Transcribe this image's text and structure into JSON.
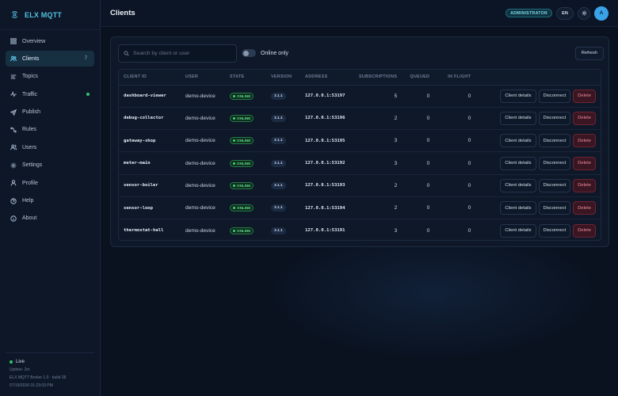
{
  "brand": {
    "name": "ELX MQTT"
  },
  "sidebar": {
    "items": [
      {
        "label": "Overview",
        "icon": "grid-icon"
      },
      {
        "label": "Clients",
        "icon": "users-icon",
        "badge": "7",
        "active": true
      },
      {
        "label": "Topics",
        "icon": "list-icon"
      },
      {
        "label": "Traffic",
        "icon": "activity-icon",
        "live": true
      },
      {
        "label": "Publish",
        "icon": "send-icon"
      },
      {
        "label": "Rules",
        "icon": "rules-icon"
      },
      {
        "label": "Users",
        "icon": "people-icon"
      },
      {
        "label": "Settings",
        "icon": "gear-icon"
      },
      {
        "label": "Profile",
        "icon": "person-icon"
      },
      {
        "label": "Help",
        "icon": "help-icon"
      },
      {
        "label": "About",
        "icon": "info-icon"
      }
    ],
    "footer": {
      "status": "Live",
      "uptime": "Uptime: 2m",
      "version": "ELX MQTT Broker 1.0 · build 28",
      "timestamp": "07/19/2026 01:23:03 PM"
    }
  },
  "header": {
    "title": "Clients",
    "role": "ADMINISTRATOR",
    "language": "EN",
    "avatar_initial": "A"
  },
  "toolbar": {
    "search_placeholder": "Search by client or user",
    "search_value": "",
    "online_only_label": "Online only",
    "online_only": false,
    "refresh_label": "Refresh"
  },
  "table": {
    "columns": [
      "CLIENT ID",
      "USER",
      "STATE",
      "VERSION",
      "ADDRESS",
      "SUBSCRIPTIONS",
      "QUEUED",
      "IN FLIGHT"
    ],
    "action_labels": {
      "details": "Client details",
      "disconnect": "Disconnect",
      "delete": "Delete"
    },
    "rows": [
      {
        "client_id": "dashboard-viewer",
        "user": "demo-device",
        "state": "ONLINE",
        "version": "3.1.1",
        "address": "127.0.0.1:53197",
        "subscriptions": "5",
        "queued": "0",
        "in_flight": "0"
      },
      {
        "client_id": "debug-collector",
        "user": "demo-device",
        "state": "ONLINE",
        "version": "3.1.1",
        "address": "127.0.0.1:53196",
        "subscriptions": "2",
        "queued": "0",
        "in_flight": "0"
      },
      {
        "client_id": "gateway-shop",
        "user": "demo-device",
        "state": "ONLINE",
        "version": "3.1.1",
        "address": "127.0.0.1:53195",
        "subscriptions": "3",
        "queued": "0",
        "in_flight": "0"
      },
      {
        "client_id": "meter-main",
        "user": "demo-device",
        "state": "ONLINE",
        "version": "3.1.1",
        "address": "127.0.0.1:53192",
        "subscriptions": "3",
        "queued": "0",
        "in_flight": "0"
      },
      {
        "client_id": "sensor-boiler",
        "user": "demo-device",
        "state": "ONLINE",
        "version": "3.1.1",
        "address": "127.0.0.1:53193",
        "subscriptions": "2",
        "queued": "0",
        "in_flight": "0"
      },
      {
        "client_id": "sensor-loop",
        "user": "demo-device",
        "state": "ONLINE",
        "version": "3.1.1",
        "address": "127.0.0.1:53194",
        "subscriptions": "2",
        "queued": "0",
        "in_flight": "0"
      },
      {
        "client_id": "thermostat-hall",
        "user": "demo-device",
        "state": "ONLINE",
        "version": "3.1.1",
        "address": "127.0.0.1:53191",
        "subscriptions": "3",
        "queued": "0",
        "in_flight": "0"
      }
    ]
  },
  "colors": {
    "accent": "#52c2e0",
    "online": "#43d47d",
    "danger": "#f08a9c",
    "background": "#0a1220"
  }
}
